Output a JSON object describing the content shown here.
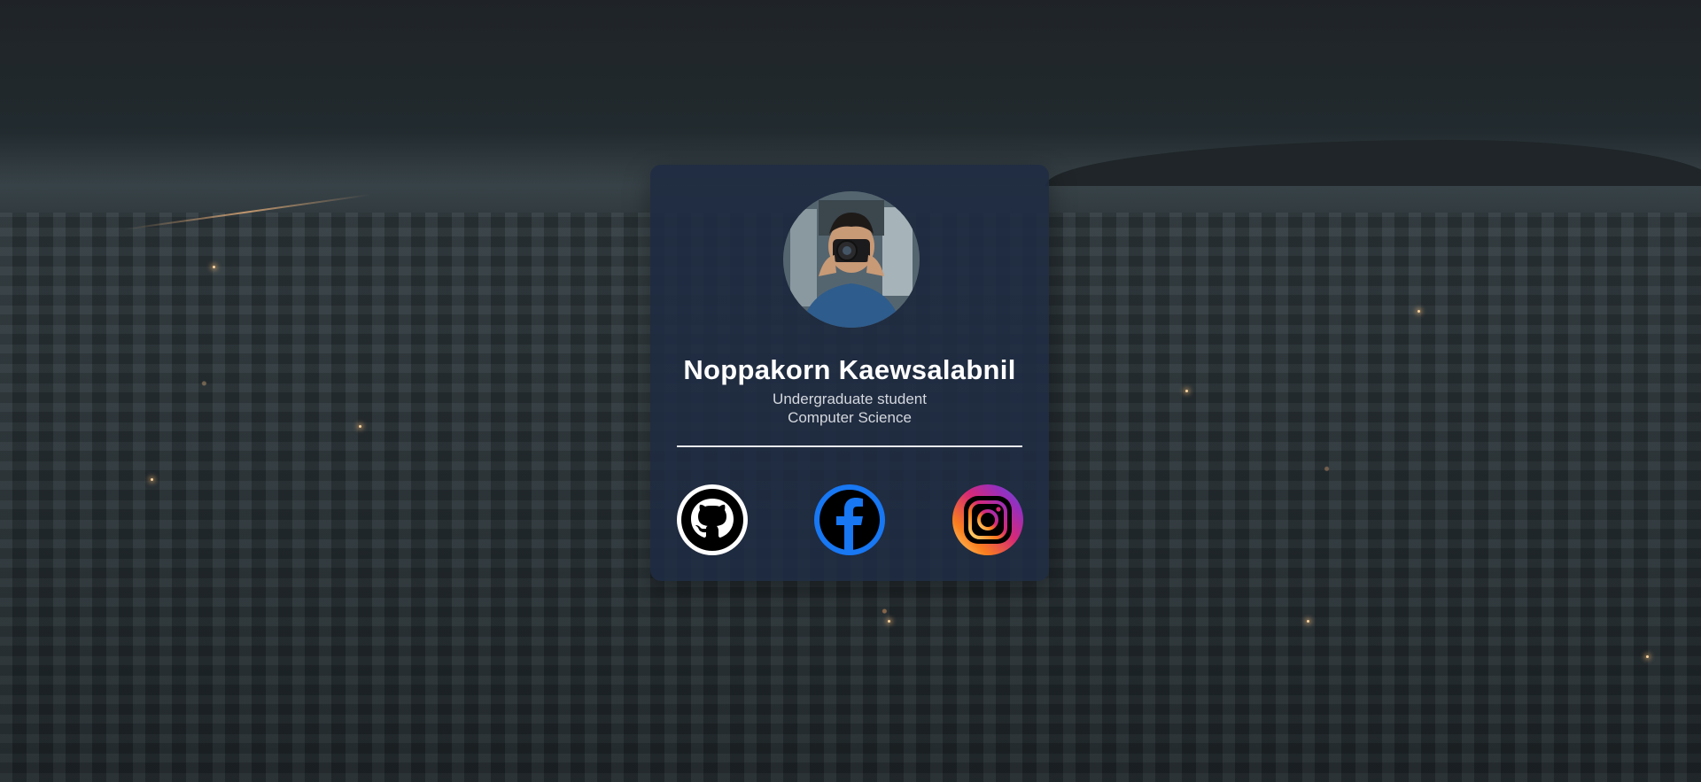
{
  "profile": {
    "name": "Noppakorn Kaewsalabnil",
    "role_line1": "Undergraduate student",
    "role_line2": "Computer Science"
  },
  "social_links": [
    {
      "icon": "github-icon"
    },
    {
      "icon": "facebook-icon"
    },
    {
      "icon": "instagram-icon"
    }
  ],
  "colors": {
    "card_background": "#1f2b42",
    "github": "#ffffff",
    "facebook": "#1877f2",
    "instagram_gradient": [
      "#feda75",
      "#fa7e1e",
      "#d62976",
      "#962fbf",
      "#4f5bd5"
    ]
  }
}
